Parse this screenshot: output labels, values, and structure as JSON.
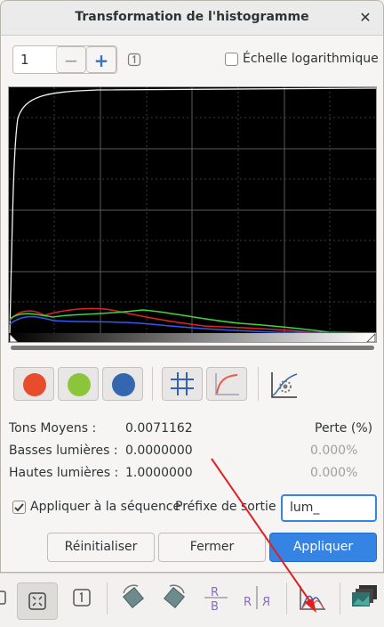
{
  "dialog": {
    "title": "Transformation de l'histogramme",
    "close_glyph": "✕"
  },
  "channel_spin": {
    "value": "1",
    "minus_glyph": "−",
    "plus_glyph": "+"
  },
  "log_scale": {
    "label": "Échelle logarithmique",
    "checked": false
  },
  "toolbar": {
    "channels": [
      {
        "name": "red-channel",
        "color": "#e74c2c"
      },
      {
        "name": "green-channel",
        "color": "#8cc53a"
      },
      {
        "name": "blue-channel",
        "color": "#3566b0"
      }
    ],
    "grid_icon": "grid-icon",
    "curve_icon": "curve-icon",
    "display_icon": "histogram-display-icon"
  },
  "stats": {
    "loss_header": "Perte (%)",
    "rows": [
      {
        "label": "Tons Moyens :",
        "value": "0.0071162",
        "loss": ""
      },
      {
        "label": "Basses lumières :",
        "value": "0.0000000",
        "loss": "0.000%"
      },
      {
        "label": "Hautes lumières :",
        "value": "1.0000000",
        "loss": "0.000%"
      }
    ]
  },
  "sequence": {
    "apply_label": "Appliquer à la séquence",
    "apply_checked": true,
    "prefix_label": "Préfixe de sortie :",
    "prefix_value": "lum_"
  },
  "buttons": {
    "reset": "Réinitialiser",
    "close": "Fermer",
    "apply": "Appliquer"
  },
  "bottom_toolbar": {
    "icons": [
      "frame-icon",
      "fit-icon",
      "small-frame-icon",
      "rotate-left-icon",
      "rotate-right-icon",
      "flip-rb-icon",
      "mirror-icon",
      "histogram-icon",
      "image-stack-icon"
    ]
  },
  "colors": {
    "accent": "#3584e4",
    "annotation_arrow": "#e02020"
  }
}
